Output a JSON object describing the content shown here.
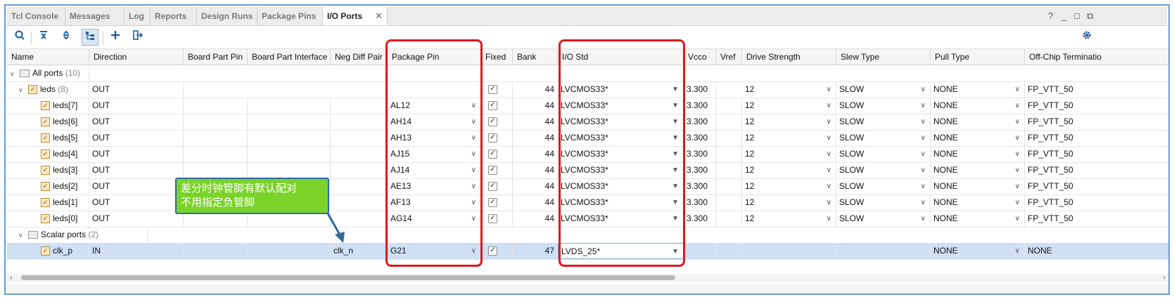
{
  "tabs": [
    {
      "label": "Tcl Console"
    },
    {
      "label": "Messages"
    },
    {
      "label": "Log"
    },
    {
      "label": "Reports"
    },
    {
      "label": "Design Runs"
    },
    {
      "label": "Package Pins"
    },
    {
      "label": "I/O Ports",
      "active": true
    }
  ],
  "window_controls": {
    "help": "?",
    "minimize": "_",
    "maximize": "□",
    "float": "⧉"
  },
  "toolbar_icons": [
    "search-icon",
    "collapse-all-icon",
    "expand-all-icon",
    "group-by-interface-icon",
    "add-icon",
    "export-icon",
    "gear-icon"
  ],
  "columns": [
    "Name",
    "Direction",
    "Board Part Pin",
    "Board Part Interface",
    "Neg Diff Pair",
    "Package Pin",
    "Fixed",
    "Bank",
    "I/O Std",
    "Vcco",
    "Vref",
    "Drive Strength",
    "Slew Type",
    "Pull Type",
    "Off-Chip Terminatio"
  ],
  "groups": {
    "all_ports": {
      "label": "All ports",
      "count": "(10)"
    },
    "leds": {
      "label": "leds",
      "count": "(8)",
      "direction": "OUT",
      "fixed": true,
      "bank": "44",
      "io_std": "LVCMOS33*",
      "vcco": "3.300",
      "drive": "12",
      "slew": "SLOW",
      "pull": "NONE",
      "term": "FP_VTT_50"
    },
    "scalar": {
      "label": "Scalar ports",
      "count": "(2)"
    }
  },
  "rows": [
    {
      "name": "leds[7]",
      "direction": "OUT",
      "package_pin": "AL12",
      "fixed": true,
      "bank": "44",
      "io_std": "LVCMOS33*",
      "vcco": "3.300",
      "drive": "12",
      "slew": "SLOW",
      "pull": "NONE",
      "term": "FP_VTT_50"
    },
    {
      "name": "leds[6]",
      "direction": "OUT",
      "package_pin": "AH14",
      "fixed": true,
      "bank": "44",
      "io_std": "LVCMOS33*",
      "vcco": "3.300",
      "drive": "12",
      "slew": "SLOW",
      "pull": "NONE",
      "term": "FP_VTT_50"
    },
    {
      "name": "leds[5]",
      "direction": "OUT",
      "package_pin": "AH13",
      "fixed": true,
      "bank": "44",
      "io_std": "LVCMOS33*",
      "vcco": "3.300",
      "drive": "12",
      "slew": "SLOW",
      "pull": "NONE",
      "term": "FP_VTT_50"
    },
    {
      "name": "leds[4]",
      "direction": "OUT",
      "package_pin": "AJ15",
      "fixed": true,
      "bank": "44",
      "io_std": "LVCMOS33*",
      "vcco": "3.300",
      "drive": "12",
      "slew": "SLOW",
      "pull": "NONE",
      "term": "FP_VTT_50"
    },
    {
      "name": "leds[3]",
      "direction": "OUT",
      "package_pin": "AJ14",
      "fixed": true,
      "bank": "44",
      "io_std": "LVCMOS33*",
      "vcco": "3.300",
      "drive": "12",
      "slew": "SLOW",
      "pull": "NONE",
      "term": "FP_VTT_50"
    },
    {
      "name": "leds[2]",
      "direction": "OUT",
      "package_pin": "AE13",
      "fixed": true,
      "bank": "44",
      "io_std": "LVCMOS33*",
      "vcco": "3.300",
      "drive": "12",
      "slew": "SLOW",
      "pull": "NONE",
      "term": "FP_VTT_50"
    },
    {
      "name": "leds[1]",
      "direction": "OUT",
      "package_pin": "AF13",
      "fixed": true,
      "bank": "44",
      "io_std": "LVCMOS33*",
      "vcco": "3.300",
      "drive": "12",
      "slew": "SLOW",
      "pull": "NONE",
      "term": "FP_VTT_50"
    },
    {
      "name": "leds[0]",
      "direction": "OUT",
      "package_pin": "AG14",
      "fixed": true,
      "bank": "44",
      "io_std": "LVCMOS33*",
      "vcco": "3.300",
      "drive": "12",
      "slew": "SLOW",
      "pull": "NONE",
      "term": "FP_VTT_50"
    }
  ],
  "clk_row": {
    "name": "clk_p",
    "direction": "IN",
    "neg_diff_pair": "clk_n",
    "package_pin": "G21",
    "fixed": true,
    "bank": "47",
    "io_std": "LVDS_25*",
    "pull": "NONE",
    "term": "NONE"
  },
  "annotation": {
    "line1": "差分时钟管脚有默认配对",
    "line2": "不用指定负管脚"
  },
  "colors": {
    "highlight_box": "#e0181d",
    "callout_fill": "#7bd32a",
    "callout_border": "#2d6aa1",
    "selected_row": "#cfe0f5"
  }
}
